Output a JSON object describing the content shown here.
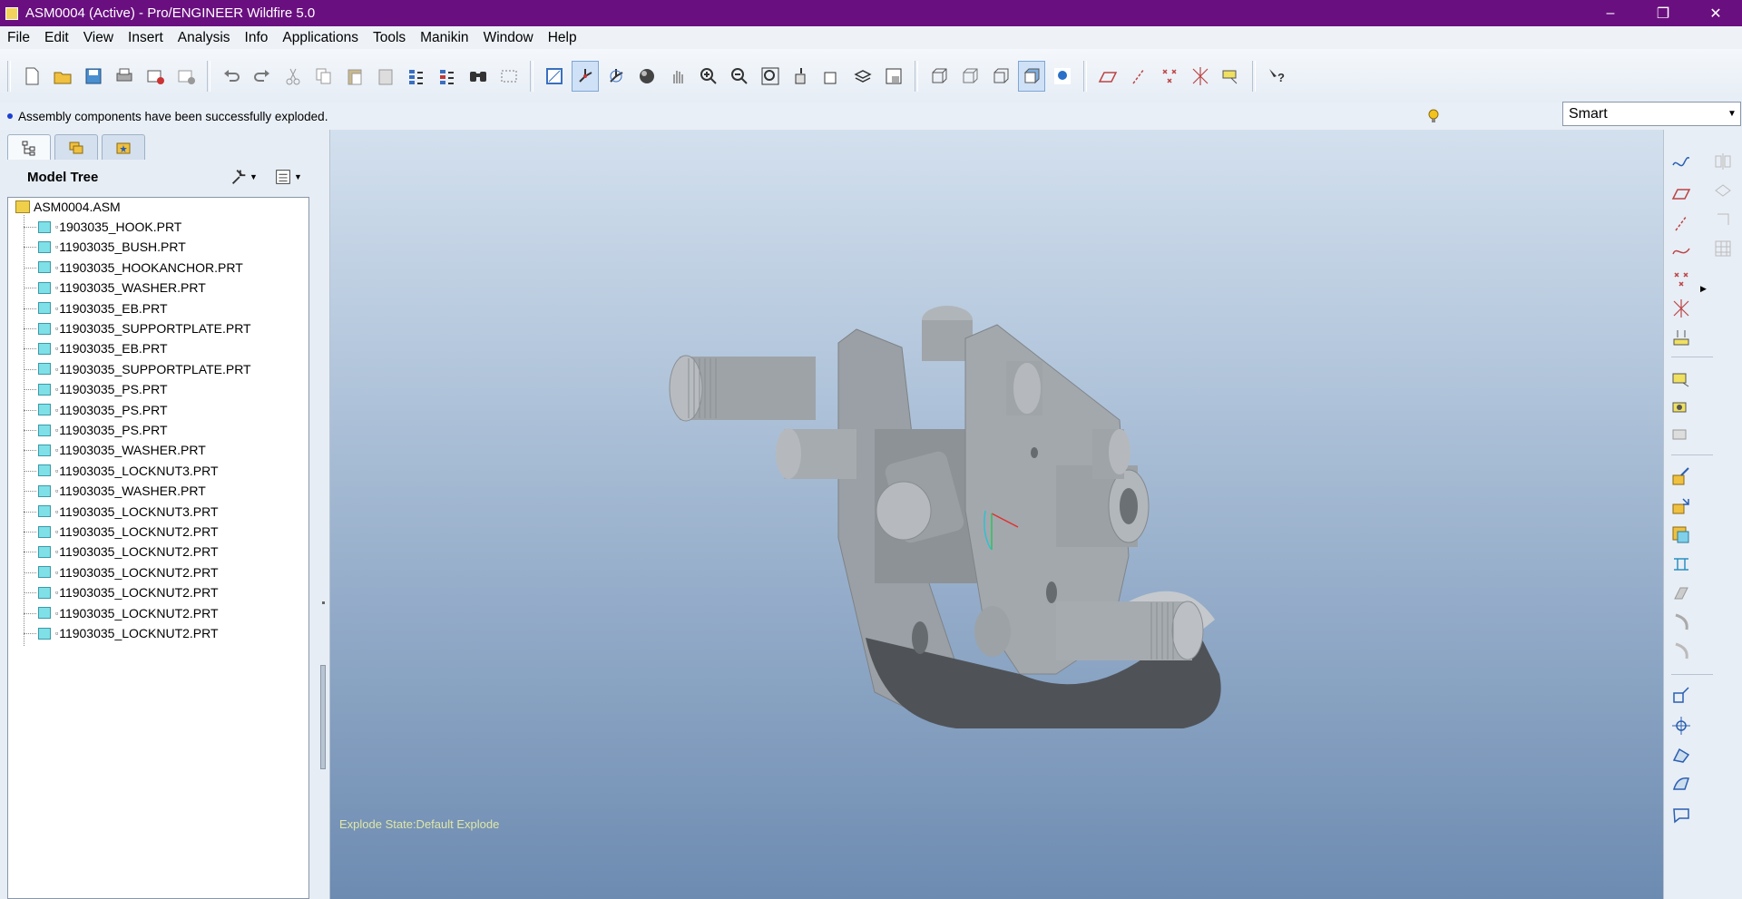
{
  "window": {
    "title": "ASM0004 (Active) - Pro/ENGINEER Wildfire 5.0",
    "controls": [
      "–",
      "❐",
      "✕"
    ]
  },
  "menu": {
    "items": [
      "File",
      "Edit",
      "View",
      "Insert",
      "Analysis",
      "Info",
      "Applications",
      "Tools",
      "Manikin",
      "Window",
      "Help"
    ]
  },
  "toolbar": {
    "icons": [
      "new-icon",
      "open-icon",
      "save-icon",
      "print-icon",
      "email-icon",
      "email-link-icon",
      "undo-icon",
      "redo-icon",
      "cut-icon",
      "copy-icon",
      "paste-icon",
      "paste-special-icon",
      "regenerate-icon",
      "regenerate-manager-icon",
      "find-icon",
      "select-box-icon",
      "repaint-icon",
      "spin-center-icon",
      "orient-mode-icon",
      "shading-icon",
      "pan-icon",
      "zoom-in-icon",
      "zoom-out-icon",
      "refit-icon",
      "reorient-icon",
      "saved-views-icon",
      "layers-icon",
      "view-manager-icon",
      "wireframe-icon",
      "hidden-line-icon",
      "no-hidden-icon",
      "shaded-icon",
      "enhanced-realism-icon",
      "datum-planes-icon",
      "datum-axes-icon",
      "datum-points-icon",
      "coordinate-systems-icon",
      "annotations-icon",
      "context-help-icon"
    ]
  },
  "message": {
    "text": "Assembly components have been successfully exploded."
  },
  "filter": {
    "selected": "Smart"
  },
  "left_panel": {
    "tabs": [
      "model-tree-tab-icon",
      "folder-browser-tab-icon",
      "favorites-tab-icon"
    ],
    "header": "Model Tree",
    "tree": {
      "root": "ASM0004.ASM",
      "items": [
        "1903035_HOOK.PRT",
        "11903035_BUSH.PRT",
        "11903035_HOOKANCHOR.PRT",
        "11903035_WASHER.PRT",
        "11903035_EB.PRT",
        "11903035_SUPPORTPLATE.PRT",
        "11903035_EB.PRT",
        "11903035_SUPPORTPLATE.PRT",
        "11903035_PS.PRT",
        "11903035_PS.PRT",
        "11903035_PS.PRT",
        "11903035_WASHER.PRT",
        "11903035_LOCKNUT3.PRT",
        "11903035_WASHER.PRT",
        "11903035_LOCKNUT3.PRT",
        "11903035_LOCKNUT2.PRT",
        "11903035_LOCKNUT2.PRT",
        "11903035_LOCKNUT2.PRT",
        "11903035_LOCKNUT2.PRT",
        "11903035_LOCKNUT2.PRT",
        "11903035_LOCKNUT2.PRT"
      ]
    }
  },
  "graphics": {
    "explode_state": "Explode State:Default Explode"
  },
  "colors": {
    "title_bar": "#6a0f80",
    "background_top": "#d3e0ee",
    "background_bottom": "#6d8bb1",
    "model_gray": "#a3a8ad"
  }
}
